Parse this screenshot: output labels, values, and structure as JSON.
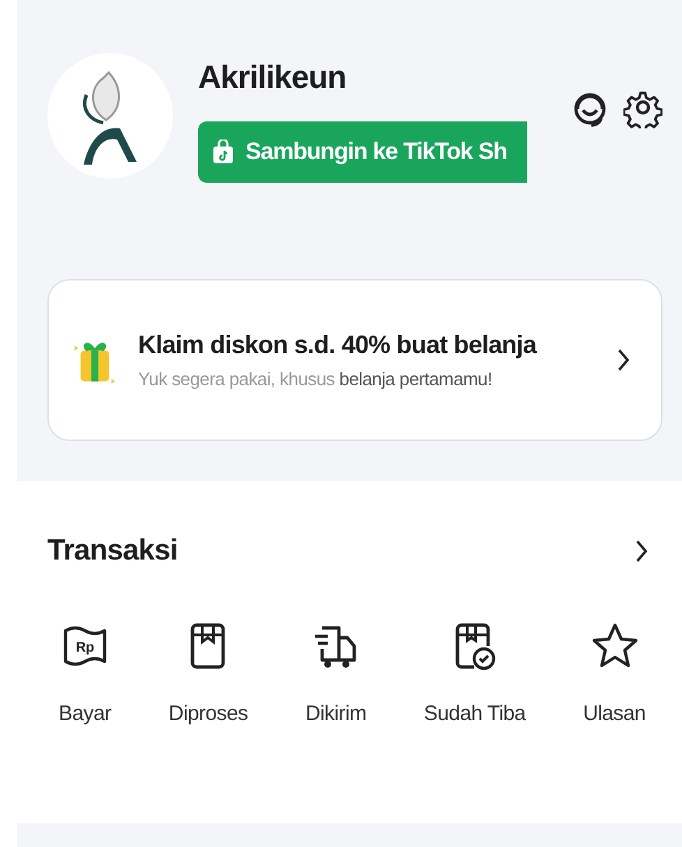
{
  "profile": {
    "name": "Akrilikeun",
    "connect_button": "Sambungin ke TikTok Sh"
  },
  "promo": {
    "title": "Klaim diskon s.d. 40% buat belanja",
    "subtitle": "Yuk segera pakai, khusus **belanja pertamamu!**"
  },
  "transactions": {
    "title": "Transaksi",
    "items": [
      {
        "kind": "pay",
        "label": "Bayar",
        "icon_text": "Rp"
      },
      {
        "kind": "box",
        "label": "Diproses"
      },
      {
        "kind": "truck",
        "label": "Dikirim"
      },
      {
        "kind": "arrived",
        "label": "Sudah Tiba"
      },
      {
        "kind": "star",
        "label": "Ulasan"
      }
    ]
  }
}
